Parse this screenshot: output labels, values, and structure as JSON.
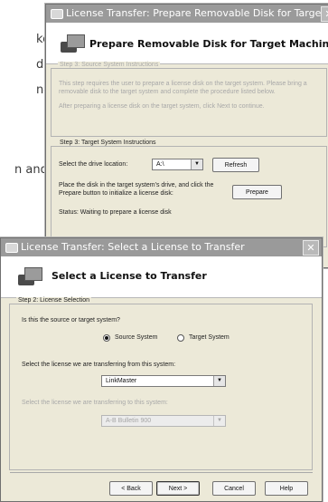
{
  "background_fragments": [
    "ke",
    "dia",
    "n-",
    "n and"
  ],
  "back_window": {
    "title": "License Transfer: Prepare Removable Disk for Target Machine",
    "close_glyph": "✕",
    "header_title": "Prepare Removable Disk for Target Machine",
    "step_source": {
      "legend": "Step 3: Source System Instructions",
      "text1": "This step requires the user to prepare a license disk on the target system.  Please bring a removable disk to the target system and complete the procedure listed below.",
      "text2": "After preparing a license disk on the target system, click Next to continue."
    },
    "step_target": {
      "legend": "Step 3: Target System Instructions",
      "drive_label": "Select the drive location:",
      "drive_value": "A:\\",
      "refresh_label": "Refresh",
      "insert_text": "Place the disk in the target system's drive, and click the Prepare button to initialize a license disk:",
      "prepare_label": "Prepare",
      "status_text": "Status: Waiting to prepare a license disk"
    }
  },
  "front_window": {
    "title": "License Transfer: Select a License to Transfer",
    "close_glyph": "✕",
    "header_title": "Select a License to Transfer",
    "step": {
      "legend": "Step 2: License Selection",
      "question": "Is this the source or target system?",
      "radio_source_label": "Source System",
      "radio_target_label": "Target System",
      "selected_radio": "source",
      "from_label": "Select the license we are transferring from this system:",
      "from_value": "LinkMaster",
      "to_label": "Select the license we are transferring to this system:",
      "to_value": "A-B Bulletin 900"
    },
    "buttons": {
      "back": "< Back",
      "next": "Next >",
      "cancel": "Cancel",
      "help": "Help"
    }
  },
  "colors": {
    "dialog_bg": "#ece9d8",
    "titlebar": "#9a9a9a",
    "disabled_text": "#a8a8a8"
  },
  "icons": [
    "window-icon",
    "close-icon",
    "license-transfer-icon",
    "dropdown-arrow-icon"
  ]
}
